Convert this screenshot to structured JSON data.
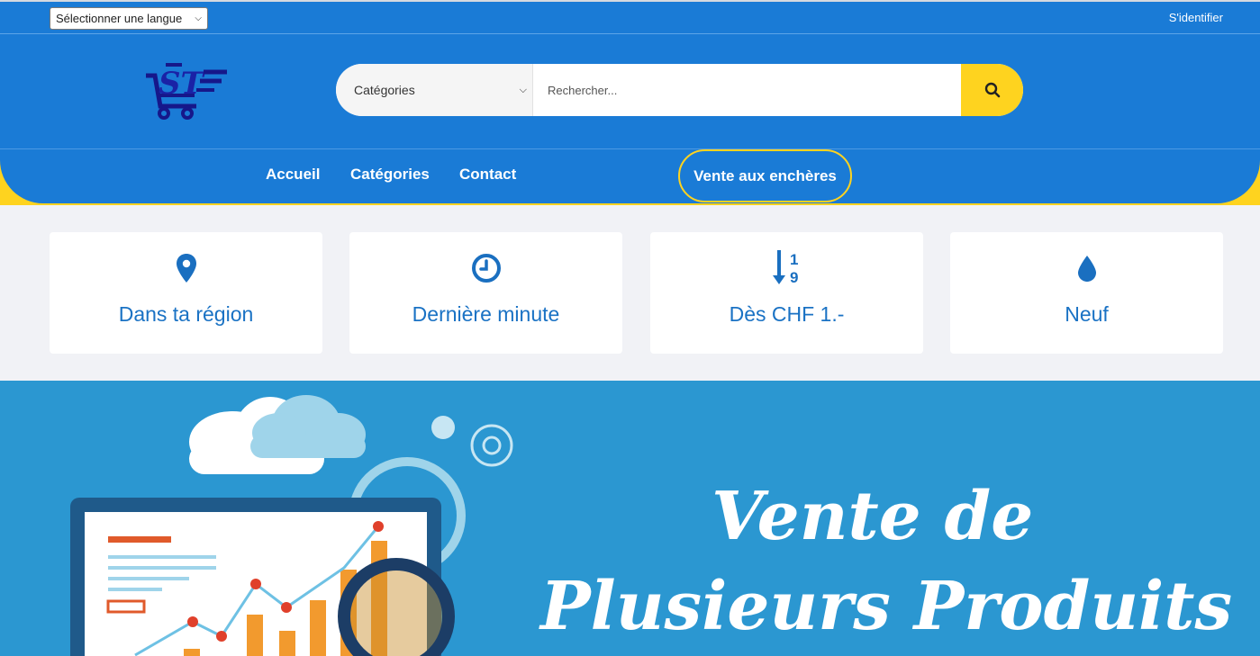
{
  "topbar": {
    "language_select": "Sélectionner une langue",
    "signin": "S'identifier"
  },
  "header": {
    "logo_text": "ST",
    "search": {
      "category_select": "Catégories",
      "placeholder": "Rechercher...",
      "button_icon": "search-icon"
    }
  },
  "nav": {
    "items": [
      {
        "label": "Accueil",
        "active": true
      },
      {
        "label": "Catégories"
      },
      {
        "label": "Contact"
      }
    ],
    "auction_button": "Vente aux enchères"
  },
  "features": [
    {
      "label": "Dans ta région",
      "icon": "map-marker-icon"
    },
    {
      "label": "Dernière minute",
      "icon": "clock-icon"
    },
    {
      "label": "Dès CHF 1.-",
      "icon": "sort-numeric-down-icon"
    },
    {
      "label": "Neuf",
      "icon": "drop-icon"
    }
  ],
  "banner": {
    "line1": "Vente de",
    "line2": "Plusieurs Produits"
  },
  "colors": {
    "primary": "#1a7bd6",
    "accent": "#fed31f",
    "text_blue": "#1a72c4",
    "banner_bg": "#2b97d1"
  }
}
